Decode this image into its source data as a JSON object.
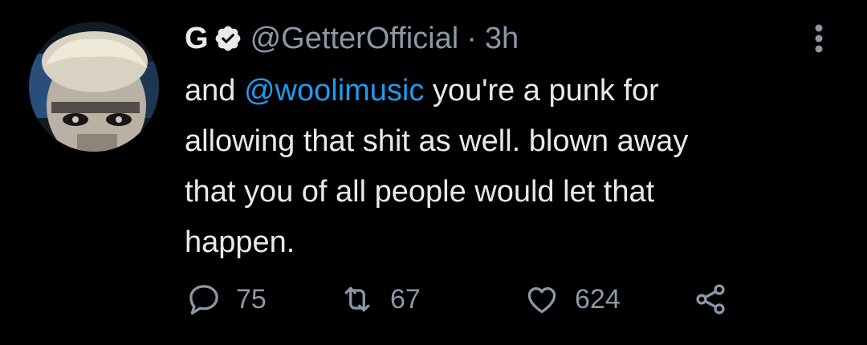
{
  "tweet": {
    "display_name": "G",
    "handle": "@GetterOfficial",
    "separator": "·",
    "time": "3h",
    "text_before_mention": "and ",
    "mention": "@woolimusic",
    "text_after_mention": " you're a punk for",
    "line2": "allowing that shit as well. blown away",
    "line3": "that you of all people would let that",
    "line4": "happen."
  },
  "actions": {
    "reply_count": "75",
    "retweet_count": "67",
    "like_count": "624"
  },
  "icons": {
    "verified": "verified-badge-icon",
    "more": "more-vertical-icon",
    "reply": "reply-icon",
    "retweet": "retweet-icon",
    "like": "heart-icon",
    "share": "share-icon"
  },
  "colors": {
    "background": "#000000",
    "text": "#e7e9ea",
    "secondary": "#8b98a5",
    "link": "#1d9bf0"
  }
}
